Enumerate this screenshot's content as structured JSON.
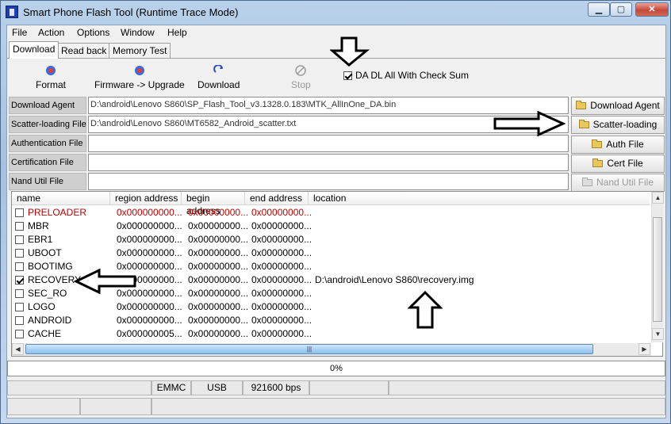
{
  "window": {
    "title": "Smart Phone Flash Tool (Runtime Trace Mode)"
  },
  "menu": [
    "File",
    "Action",
    "Options",
    "Window",
    "Help"
  ],
  "tabs": [
    "Download",
    "Read back",
    "Memory Test"
  ],
  "toolbar": {
    "format": "Format",
    "firmware_upgrade": "Firmware -> Upgrade",
    "download": "Download",
    "stop": "Stop",
    "checksum_label": "DA DL All With Check Sum",
    "checksum_checked": true
  },
  "fields": {
    "download_agent": {
      "label": "Download Agent",
      "value": "D:\\android\\Lenovo S860\\SP_Flash_Tool_v3.1328.0.183\\MTK_AllInOne_DA.bin",
      "button": "Download Agent"
    },
    "scatter": {
      "label": "Scatter-loading File",
      "value": "D:\\android\\Lenovo S860\\MT6582_Android_scatter.txt",
      "button": "Scatter-loading"
    },
    "auth": {
      "label": "Authentication File",
      "value": "",
      "button": "Auth File"
    },
    "cert": {
      "label": "Certification File",
      "value": "",
      "button": "Cert File"
    },
    "nand": {
      "label": "Nand Util File",
      "value": "",
      "button": "Nand Util File"
    }
  },
  "table": {
    "columns": [
      "name",
      "region address",
      "begin address",
      "end address",
      "location"
    ],
    "rows": [
      {
        "name": "PRELOADER",
        "region": "0x000000000...",
        "begin": "0x00000000...",
        "end": "0x00000000...",
        "location": "",
        "checked": false,
        "red": true
      },
      {
        "name": "MBR",
        "region": "0x000000000...",
        "begin": "0x00000000...",
        "end": "0x00000000...",
        "location": "",
        "checked": false,
        "red": false
      },
      {
        "name": "EBR1",
        "region": "0x000000000...",
        "begin": "0x00000000...",
        "end": "0x00000000...",
        "location": "",
        "checked": false,
        "red": false
      },
      {
        "name": "UBOOT",
        "region": "0x000000000...",
        "begin": "0x00000000...",
        "end": "0x00000000...",
        "location": "",
        "checked": false,
        "red": false
      },
      {
        "name": "BOOTIMG",
        "region": "0x000000000...",
        "begin": "0x00000000...",
        "end": "0x00000000...",
        "location": "",
        "checked": false,
        "red": false
      },
      {
        "name": "RECOVERY",
        "region": "0x000000000...",
        "begin": "0x00000000...",
        "end": "0x00000000...",
        "location": "D:\\android\\Lenovo S860\\recovery.img",
        "checked": true,
        "red": false
      },
      {
        "name": "SEC_RO",
        "region": "0x000000000...",
        "begin": "0x00000000...",
        "end": "0x00000000...",
        "location": "",
        "checked": false,
        "red": false
      },
      {
        "name": "LOGO",
        "region": "0x000000000...",
        "begin": "0x00000000...",
        "end": "0x00000000...",
        "location": "",
        "checked": false,
        "red": false
      },
      {
        "name": "ANDROID",
        "region": "0x000000000...",
        "begin": "0x00000000...",
        "end": "0x00000000...",
        "location": "",
        "checked": false,
        "red": false
      },
      {
        "name": "CACHE",
        "region": "0x000000005...",
        "begin": "0x00000000...",
        "end": "0x00000000...",
        "location": "",
        "checked": false,
        "red": false
      }
    ]
  },
  "progress": {
    "text": "0%",
    "value": 0
  },
  "status": {
    "storage": "EMMC",
    "connection": "USB",
    "baud": "921600 bps"
  }
}
